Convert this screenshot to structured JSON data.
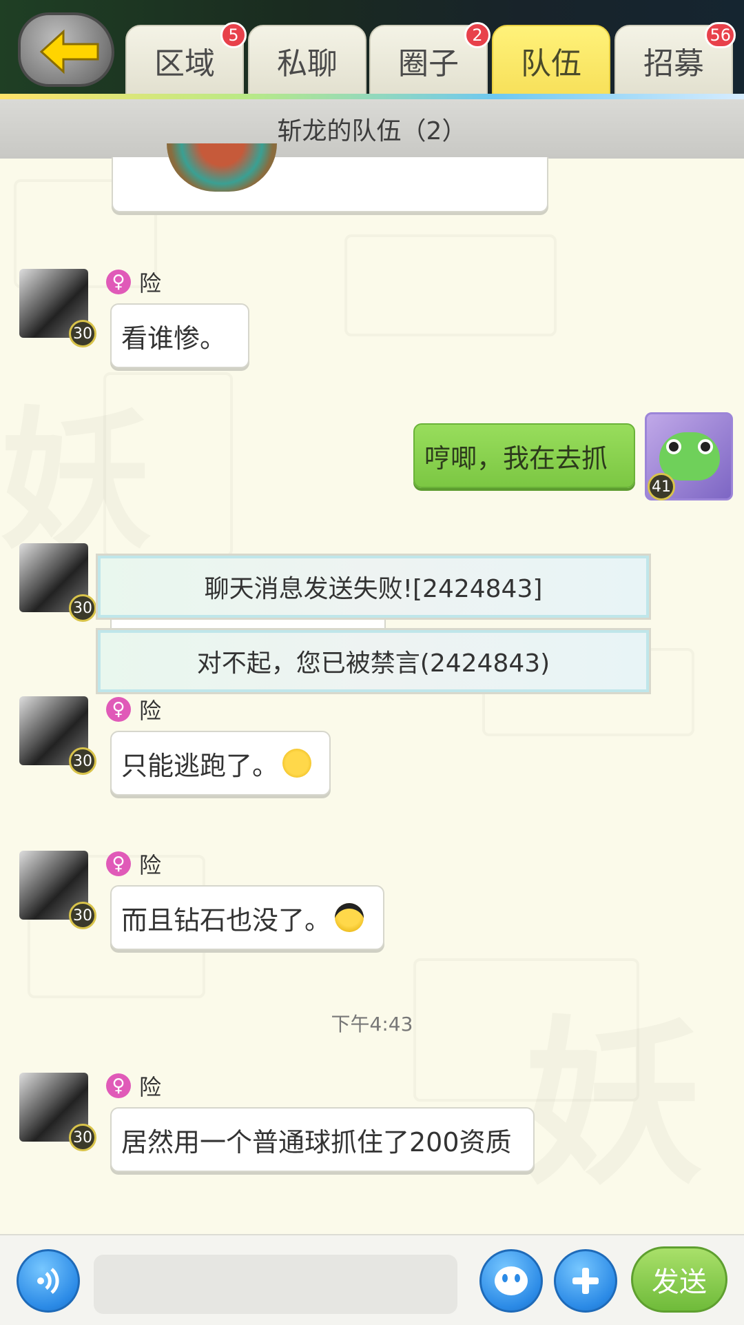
{
  "header": {
    "tabs": [
      {
        "label": "区域",
        "badge": "5"
      },
      {
        "label": "私聊",
        "badge": ""
      },
      {
        "label": "圈子",
        "badge": "2"
      },
      {
        "label": "队伍",
        "badge": ""
      },
      {
        "label": "招募",
        "badge": "56"
      }
    ],
    "active_tab": "队伍",
    "title": "斩龙的队伍（2）"
  },
  "messages": [
    {
      "sender": "险",
      "level": "30",
      "text": "看谁惨。"
    },
    {
      "sender": "me",
      "level": "41",
      "text": "哼唧，我在去抓"
    },
    {
      "sender": "险",
      "level": "30",
      "text": ""
    },
    {
      "sender": "险",
      "level": "30",
      "text": "只能逃跑了。",
      "emoji": "crying-face-icon"
    },
    {
      "sender": "险",
      "level": "30",
      "text": "而且钻石也没了。",
      "emoji": "sunglasses-face-icon"
    },
    {
      "sender": "险",
      "level": "30",
      "text": "居然用一个普通球抓住了200资质"
    }
  ],
  "toasts": [
    "聊天消息发送失败![2424843]",
    "对不起，您已被禁言(2424843)"
  ],
  "timestamp": "下午4:43",
  "footer": {
    "input_placeholder": "",
    "send_label": "发送"
  },
  "colors": {
    "accent_green": "#7cc743",
    "active_tab": "#f7e05a",
    "badge_red": "#e8414b",
    "female_pink": "#e05ab8"
  }
}
